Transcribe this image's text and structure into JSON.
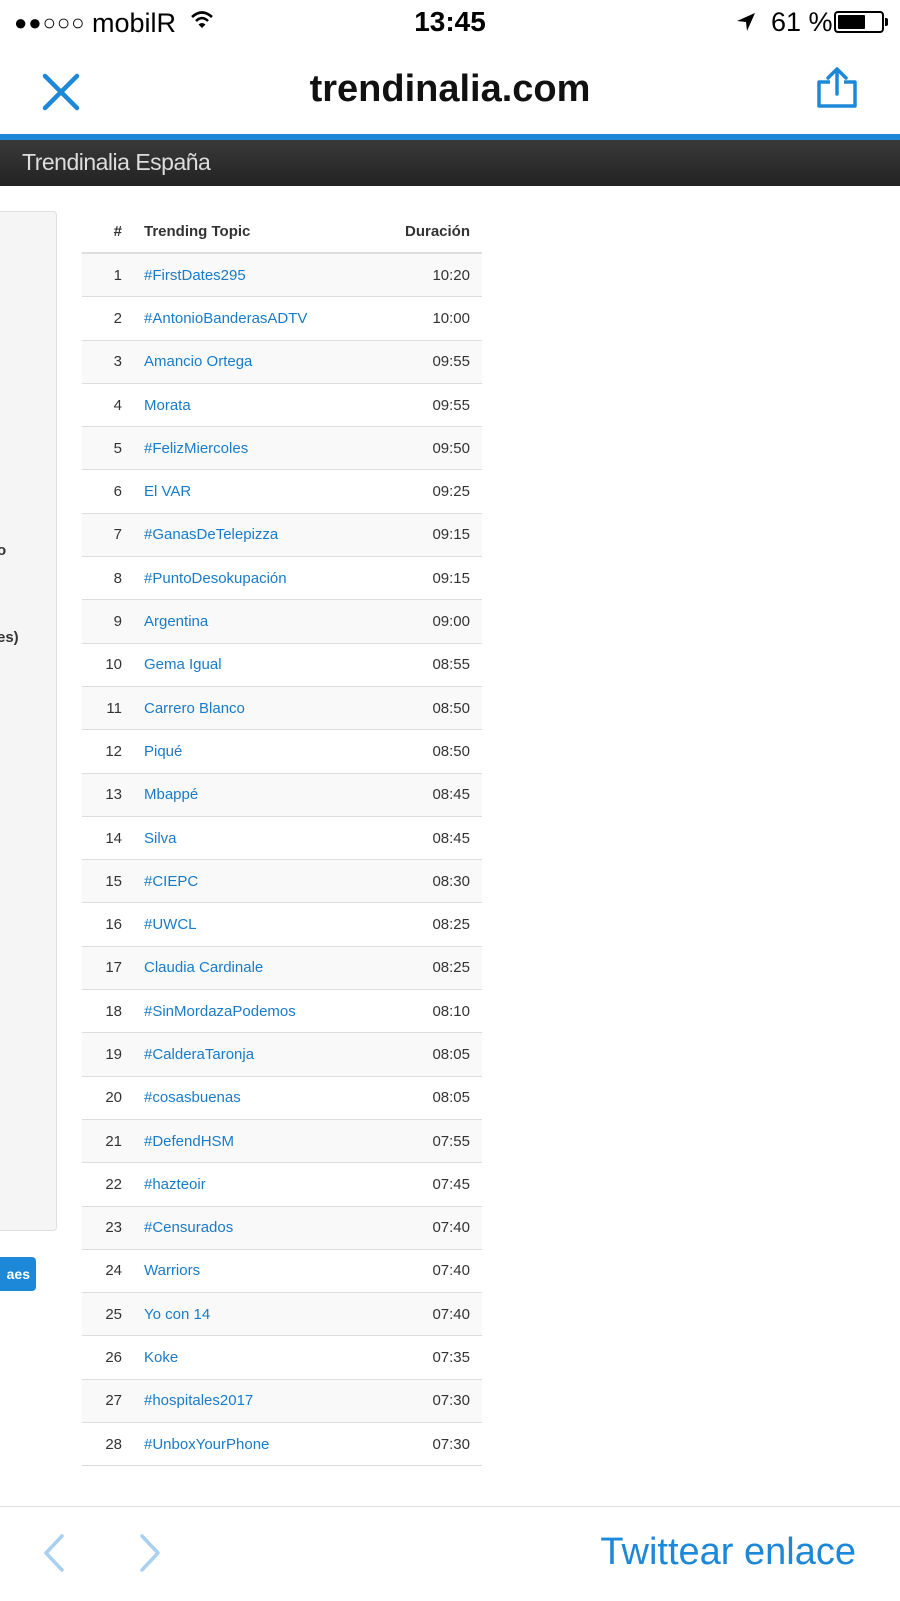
{
  "status_bar": {
    "signal": "●●○○○",
    "carrier": "mobilR",
    "time": "13:45",
    "battery_percent": "61 %",
    "battery_level": 0.61
  },
  "nav": {
    "title": "trendinalia.com",
    "close_icon": "close-icon",
    "share_icon": "share-icon"
  },
  "site_header": {
    "brand": "Trendinalia España"
  },
  "side_panel": {
    "fragment_1": "o",
    "fragment_2": "es)",
    "button_label": "aes"
  },
  "table": {
    "headers": {
      "num": "#",
      "topic": "Trending Topic",
      "duration": "Duración"
    },
    "rows": [
      {
        "num": "1",
        "topic": "#FirstDates295",
        "duration": "10:20"
      },
      {
        "num": "2",
        "topic": "#AntonioBanderasADTV",
        "duration": "10:00"
      },
      {
        "num": "3",
        "topic": "Amancio Ortega",
        "duration": "09:55"
      },
      {
        "num": "4",
        "topic": "Morata",
        "duration": "09:55"
      },
      {
        "num": "5",
        "topic": "#FelizMiercoles",
        "duration": "09:50"
      },
      {
        "num": "6",
        "topic": "El VAR",
        "duration": "09:25"
      },
      {
        "num": "7",
        "topic": "#GanasDeTelepizza",
        "duration": "09:15"
      },
      {
        "num": "8",
        "topic": "#PuntoDesokupación",
        "duration": "09:15"
      },
      {
        "num": "9",
        "topic": "Argentina",
        "duration": "09:00"
      },
      {
        "num": "10",
        "topic": "Gema Igual",
        "duration": "08:55"
      },
      {
        "num": "11",
        "topic": "Carrero Blanco",
        "duration": "08:50"
      },
      {
        "num": "12",
        "topic": "Piqué",
        "duration": "08:50"
      },
      {
        "num": "13",
        "topic": "Mbappé",
        "duration": "08:45"
      },
      {
        "num": "14",
        "topic": "Silva",
        "duration": "08:45"
      },
      {
        "num": "15",
        "topic": "#CIEPC",
        "duration": "08:30"
      },
      {
        "num": "16",
        "topic": "#UWCL",
        "duration": "08:25"
      },
      {
        "num": "17",
        "topic": "Claudia Cardinale",
        "duration": "08:25"
      },
      {
        "num": "18",
        "topic": "#SinMordazaPodemos",
        "duration": "08:10"
      },
      {
        "num": "19",
        "topic": "#CalderaTaronja",
        "duration": "08:05"
      },
      {
        "num": "20",
        "topic": "#cosasbuenas",
        "duration": "08:05"
      },
      {
        "num": "21",
        "topic": "#DefendHSM",
        "duration": "07:55"
      },
      {
        "num": "22",
        "topic": "#hazteoir",
        "duration": "07:45"
      },
      {
        "num": "23",
        "topic": "#Censurados",
        "duration": "07:40"
      },
      {
        "num": "24",
        "topic": "Warriors",
        "duration": "07:40"
      },
      {
        "num": "25",
        "topic": "Yo con 14",
        "duration": "07:40"
      },
      {
        "num": "26",
        "topic": "Koke",
        "duration": "07:35"
      },
      {
        "num": "27",
        "topic": "#hospitales2017",
        "duration": "07:30"
      },
      {
        "num": "28",
        "topic": "#UnboxYourPhone",
        "duration": "07:30"
      }
    ]
  },
  "bottom_bar": {
    "tweet_label": "Twittear enlace"
  },
  "colors": {
    "accent": "#1e88d8",
    "link": "#1a7bc9",
    "header_bg": "#2a2a2a"
  }
}
